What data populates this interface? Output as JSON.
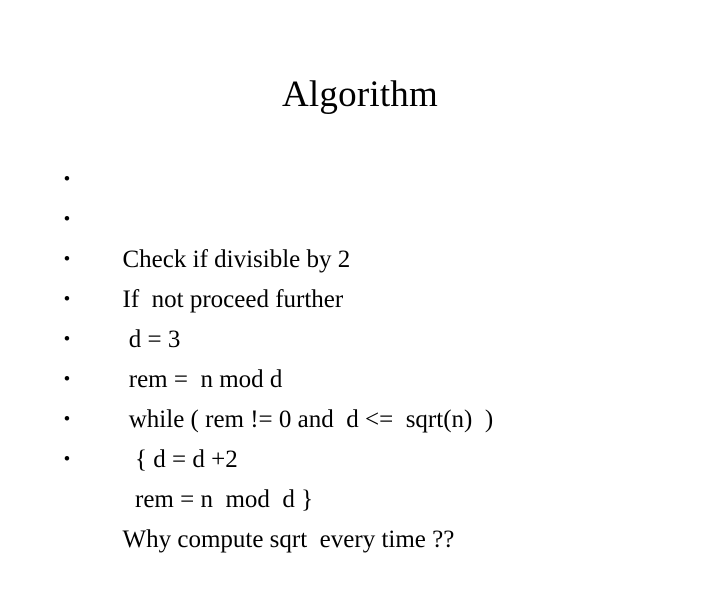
{
  "slide": {
    "title": "Algorithm",
    "background_color": "#ffffff",
    "text_color": "#000000",
    "bullet_marker": "•",
    "bullets": [
      {
        "text": "Check if divisible by 2"
      },
      {
        "text": "If  not proceed further"
      },
      {
        "text": " d = 3"
      },
      {
        "text": " rem =  n mod d"
      },
      {
        "text": " while ( rem != 0 and  d <=  sqrt(n)  )"
      },
      {
        "text": "  { d = d +2"
      },
      {
        "text": "  rem = n  mod  d }"
      },
      {
        "text": "Why compute sqrt  every time ??"
      }
    ]
  }
}
